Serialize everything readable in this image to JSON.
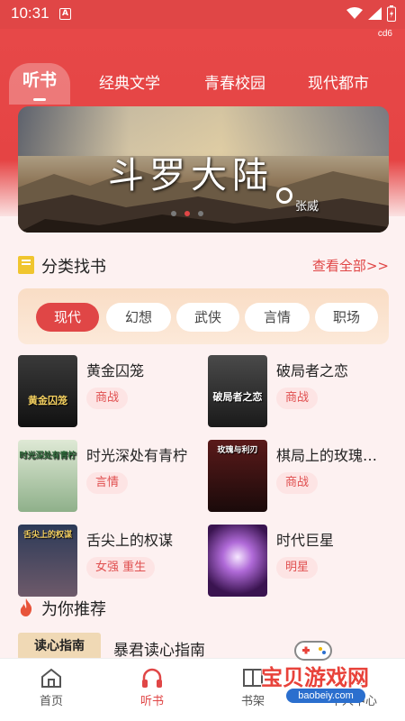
{
  "status": {
    "time": "10:31",
    "notif_letter": "A",
    "corner_label": "cd6"
  },
  "tabs": [
    "听书",
    "经典文学",
    "青春校园",
    "现代都市"
  ],
  "banner": {
    "title": "斗罗大陆",
    "subtitle": "张威"
  },
  "category": {
    "title": "分类找书",
    "more": "查看全部>>"
  },
  "genres": [
    "现代",
    "幻想",
    "武侠",
    "言情",
    "职场"
  ],
  "books": [
    {
      "title": "黄金囚笼",
      "tag": "商战",
      "cover_text": "黄金囚笼"
    },
    {
      "title": "破局者之恋",
      "tag": "商战",
      "cover_text": "破局者之恋"
    },
    {
      "title": "时光深处有青柠",
      "tag": "言情",
      "cover_text": "时光深处有青柠"
    },
    {
      "title": "棋局上的玫瑰…",
      "tag": "商战",
      "cover_text": "玫瑰与利刃"
    },
    {
      "title": "舌尖上的权谋",
      "tag": "女强 重生",
      "cover_text": "舌尖上的权谋"
    },
    {
      "title": "时代巨星",
      "tag": "明星",
      "cover_text": ""
    }
  ],
  "recommend": {
    "title": "为你推荐",
    "book_title": "暴君读心指南",
    "cover_text": "读心指南"
  },
  "nav": [
    "首页",
    "听书",
    "书架",
    "个人中心"
  ],
  "watermark": {
    "text": "宝贝游戏网",
    "url": "baobeiy.com"
  },
  "colors": {
    "accent": "#e04646",
    "tag_bg": "#fde4e4",
    "genre_panel": "#f9ddc5"
  }
}
